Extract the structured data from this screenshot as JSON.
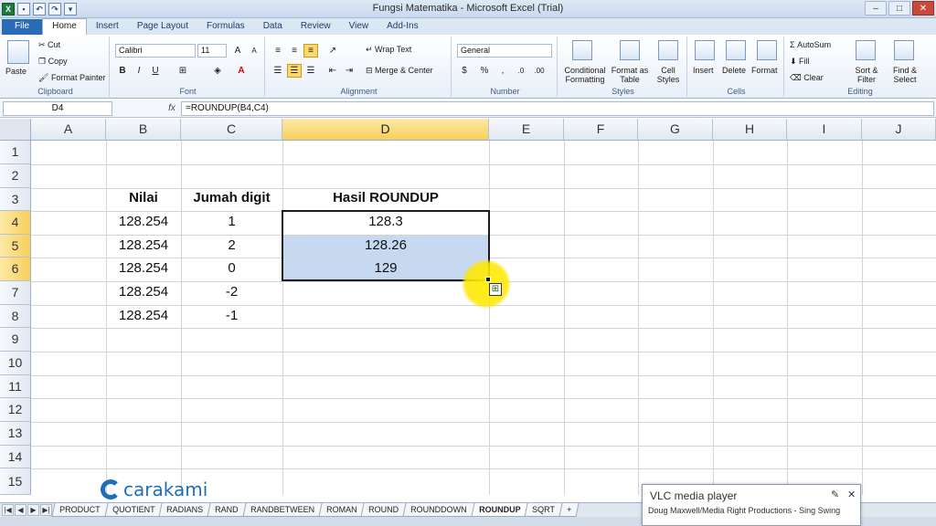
{
  "window": {
    "title": "Fungsi Matematika - Microsoft Excel (Trial)"
  },
  "ribbon": {
    "tabs": [
      "File",
      "Home",
      "Insert",
      "Page Layout",
      "Formulas",
      "Data",
      "Review",
      "View",
      "Add-Ins"
    ],
    "active_tab": "Home",
    "clipboard": {
      "label": "Clipboard",
      "paste": "Paste",
      "cut": "Cut",
      "copy": "Copy",
      "format_painter": "Format Painter"
    },
    "font": {
      "label": "Font",
      "name": "Calibri",
      "size": "11"
    },
    "alignment": {
      "label": "Alignment",
      "wrap": "Wrap Text",
      "merge": "Merge & Center"
    },
    "number": {
      "label": "Number",
      "format": "General"
    },
    "styles": {
      "label": "Styles",
      "conditional": "Conditional Formatting",
      "format_table": "Format as Table",
      "cell_styles": "Cell Styles"
    },
    "cells": {
      "label": "Cells",
      "insert": "Insert",
      "delete": "Delete",
      "format": "Format"
    },
    "editing": {
      "label": "Editing",
      "autosum": "AutoSum",
      "fill": "Fill",
      "clear": "Clear",
      "sort": "Sort & Filter",
      "find": "Find & Select"
    }
  },
  "formula_bar": {
    "name_box": "D4",
    "fx": "fx",
    "formula": "=ROUNDUP(B4,C4)"
  },
  "grid": {
    "columns": [
      "A",
      "B",
      "C",
      "D",
      "E",
      "F",
      "G",
      "H",
      "I",
      "J"
    ],
    "rows": [
      "1",
      "2",
      "3",
      "4",
      "5",
      "6",
      "7",
      "8",
      "9",
      "10",
      "11",
      "12",
      "13",
      "14",
      "15"
    ],
    "headers": {
      "b": "Nilai",
      "c": "Jumah digit",
      "d": "Hasil ROUNDUP"
    },
    "data": [
      {
        "b": "128.254",
        "c": "1",
        "d": "128.3"
      },
      {
        "b": "128.254",
        "c": "2",
        "d": "128.26"
      },
      {
        "b": "128.254",
        "c": "0",
        "d": "129"
      },
      {
        "b": "128.254",
        "c": "-2",
        "d": ""
      },
      {
        "b": "128.254",
        "c": "-1",
        "d": ""
      }
    ]
  },
  "sheets": {
    "tabs": [
      "PRODUCT",
      "QUOTIENT",
      "RADIANS",
      "RAND",
      "RANDBETWEEN",
      "ROMAN",
      "ROUND",
      "ROUNDDOWN",
      "ROUNDUP",
      "SQRT"
    ],
    "active": "ROUNDUP"
  },
  "watermark": {
    "text": "carakami"
  },
  "notification": {
    "title": "VLC media player",
    "subtitle": "Doug Maxwell/Media Right Productions - Sing Swing"
  }
}
